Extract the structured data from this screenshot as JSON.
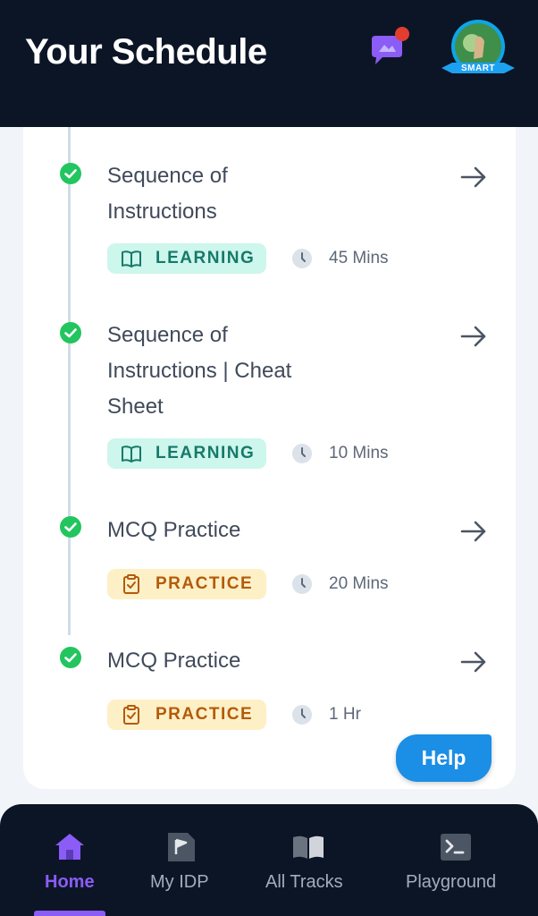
{
  "header": {
    "title": "Your Schedule",
    "chat_icon": "chat-bubble-icon",
    "avatar_badge": "SMART"
  },
  "schedule": {
    "items": [
      {
        "title_lines": [
          "Sequence of",
          "Instructions"
        ],
        "status": "completed",
        "tag": "LEARNING",
        "tag_icon": "book-icon",
        "duration": "45 Mins"
      },
      {
        "title_lines": [
          "Sequence of",
          "Instructions | Cheat",
          "Sheet"
        ],
        "status": "completed",
        "tag": "LEARNING",
        "tag_icon": "book-icon",
        "duration": "10 Mins"
      },
      {
        "title_lines": [
          "MCQ Practice"
        ],
        "status": "completed",
        "tag": "PRACTICE",
        "tag_icon": "clipboard-check-icon",
        "duration": "20 Mins"
      },
      {
        "title_lines": [
          "MCQ Practice"
        ],
        "status": "completed",
        "tag": "PRACTICE",
        "tag_icon": "clipboard-check-icon",
        "duration": "1 Hr"
      }
    ]
  },
  "help": {
    "label": "Help"
  },
  "nav": {
    "items": [
      {
        "label": "Home",
        "icon": "home-icon",
        "active": true
      },
      {
        "label": "My IDP",
        "icon": "flag-document-icon",
        "active": false
      },
      {
        "label": "All Tracks",
        "icon": "open-book-icon",
        "active": false
      },
      {
        "label": "Playground",
        "icon": "terminal-icon",
        "active": false
      }
    ]
  },
  "colors": {
    "header_bg": "#0c1526",
    "learning_bg": "#cdf6ec",
    "learning_text": "#17796a",
    "practice_bg": "#fdf0c6",
    "practice_text": "#b35b0a",
    "check_green": "#22c55e",
    "help_blue": "#1b8ee6",
    "nav_active": "#8b5cf6"
  }
}
